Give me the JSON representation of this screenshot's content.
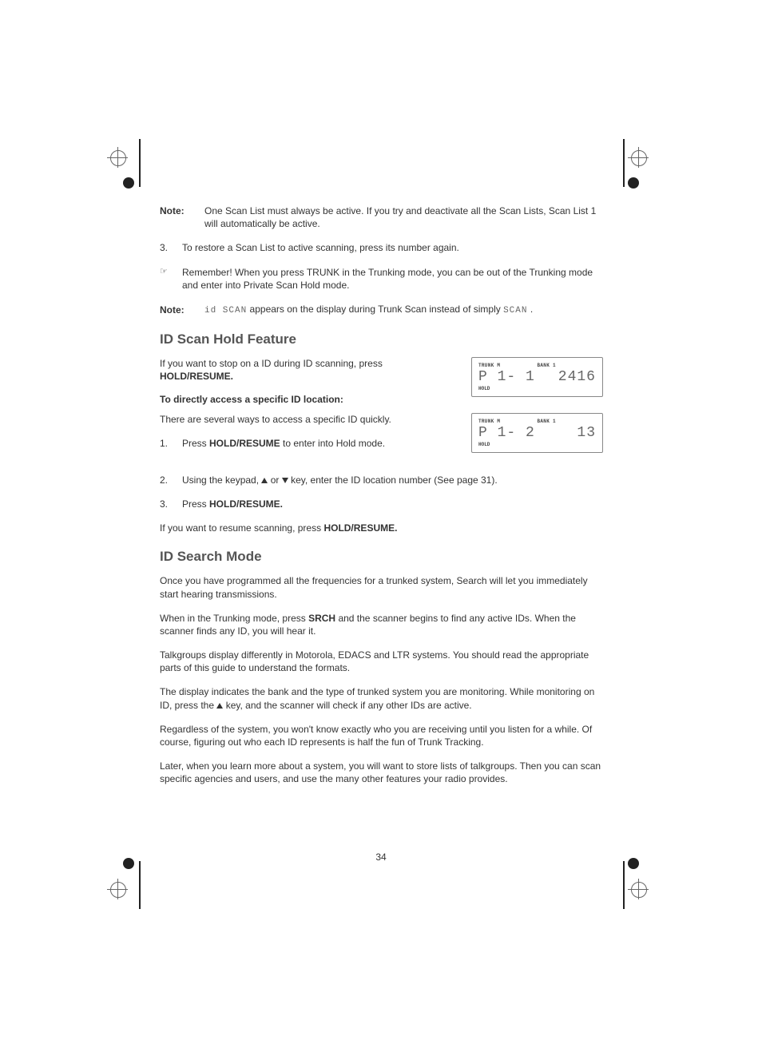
{
  "pageNumber": "34",
  "note1": {
    "label": "Note:",
    "text": "One Scan List must always be active. If you try and deactivate all the Scan Lists, Scan List 1 will automatically be active."
  },
  "step3_top": {
    "num": "3.",
    "text": "To restore a Scan List to active scanning, press its number again."
  },
  "hand": {
    "icon": "☞",
    "text": "Remember! When you press TRUNK in the Trunking mode, you can be out of the Trunking mode and enter into Private Scan Hold mode."
  },
  "note2": {
    "label": "Note:",
    "before": "",
    "seg1": "id SCAN",
    "mid": " appears on the display during Trunk Scan instead of simply ",
    "seg2": "SCAN",
    "after": " ."
  },
  "h_scanHold": "ID Scan Hold Feature",
  "scanHold_p1_a": "If you want to stop on a ID during ID scanning, press ",
  "scanHold_p1_b": "HOLD/RESUME.",
  "sub_direct": "To directly access a specific ID location:",
  "direct_intro": "There are several ways to access a specific ID quickly.",
  "d_step1": {
    "num": "1.",
    "a": "Press ",
    "b": "HOLD/RESUME",
    "c": " to enter into Hold mode."
  },
  "d_step2": {
    "num": "2.",
    "a": "Using the keypad, ",
    "b": " or ",
    "c": " key, enter the ID location number (See page 31)."
  },
  "d_step3": {
    "num": "3.",
    "a": "Press ",
    "b": "HOLD/RESUME."
  },
  "resume_a": "If you want to resume scanning, press ",
  "resume_b": "HOLD/RESUME.",
  "h_search": "ID Search Mode",
  "s_p1": "Once you have programmed all the frequencies for a trunked system, Search will let you immediately start hearing transmissions.",
  "s_p2_a": "When in the Trunking mode, press ",
  "s_p2_b": "SRCH",
  "s_p2_c": " and the scanner begins to find any active IDs. When the scanner finds any ID, you will hear it.",
  "s_p3": "Talkgroups display differently in Motorola, EDACS and LTR systems. You should read the appropriate parts of this guide to understand the formats.",
  "s_p4_a": "The display indicates the bank and the type of trunked system you are monitoring. While monitoring on ID, press the ",
  "s_p4_b": " key, and the scanner will check if any other IDs are active.",
  "s_p5": "Regardless of the system, you won't know exactly who you are receiving until you listen for a while. Of course, figuring out who each ID represents is half the fun of Trunk Tracking.",
  "s_p6": "Later, when you learn more about a system, you will want to store lists of talkgroups. Then you can scan specific agencies and users, and use the many other features your radio provides.",
  "lcd1": {
    "t1": "TRUNK M",
    "t2": "BANK 1",
    "left": "P 1- 1",
    "right": "2416",
    "bottom": "HOLD"
  },
  "lcd2": {
    "t1": "TRUNK M",
    "t2": "BANK 1",
    "left": "P 1- 2",
    "right": "13",
    "bottom": "HOLD"
  }
}
